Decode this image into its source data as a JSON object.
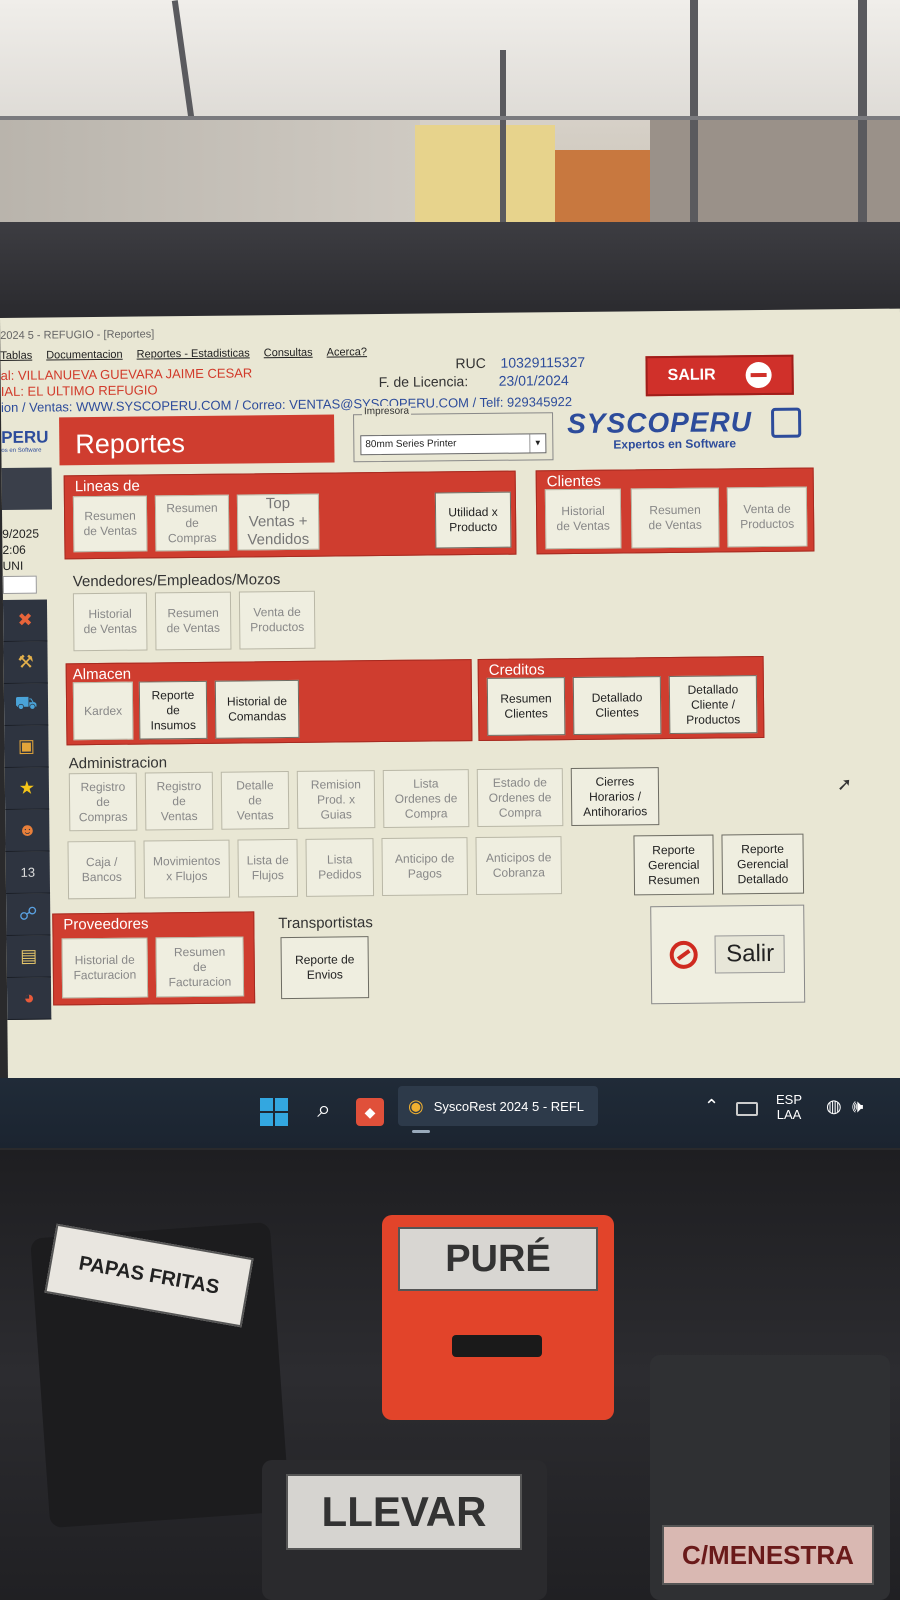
{
  "app": {
    "titlebar": "2024 5 - REFUGIO - [Reportes]",
    "menu": [
      "Tablas",
      "Documentacion",
      "Reportes - Estadisticas",
      "Consultas",
      "Acerca?"
    ],
    "owner": "al: VILLANUEVA GUEVARA JAIME CESAR",
    "branch": "IAL: EL ULTIMO REFUGIO",
    "contact": "ion / Ventas: WWW.SYSCOPERU.COM / Correo: VENTAS@SYSCOPERU.COM / Telf: 929345922",
    "ruc_label": "RUC",
    "ruc_value": "10329115327",
    "license_label": "F. de Licencia:",
    "license_value": "23/01/2024",
    "salir_top": "SALIR"
  },
  "sidebar": {
    "logo": "PERU",
    "logo_sub": "os en Software",
    "date": "9/2025",
    "time": "2:06",
    "user": "UNI",
    "tool_icons": [
      "tools-icon",
      "hammer-icon",
      "truck-icon",
      "box-icon",
      "star-icon",
      "people-icon",
      "calendar-icon",
      "user-network-icon",
      "notebook-icon",
      "pie-chart-icon"
    ]
  },
  "header": {
    "title": "Reportes",
    "printer_label": "Impresora",
    "printer_value": "80mm Series Printer",
    "brand": "SYSCOPERU",
    "brand_sub": "Expertos en Software"
  },
  "groups": {
    "lineas": {
      "title": "Lineas de",
      "buttons": [
        "Resumen\nde Ventas",
        "Resumen\nde\nCompras",
        "Top\nVentas +\nVendidos",
        "Utilidad x\nProducto"
      ]
    },
    "clientes": {
      "title": "Clientes",
      "buttons": [
        "Historial\nde Ventas",
        "Resumen\nde Ventas",
        "Venta de\nProductos"
      ]
    },
    "vendedores": {
      "title": "Vendedores/Empleados/Mozos",
      "buttons": [
        "Historial\nde Ventas",
        "Resumen\nde Ventas",
        "Venta de\nProductos"
      ]
    },
    "almacen": {
      "title": "Almacen",
      "buttons": [
        "Kardex",
        "Reporte\nde\nInsumos",
        "Historial de\nComandas"
      ]
    },
    "creditos": {
      "title": "Creditos",
      "buttons": [
        "Resumen\nClientes",
        "Detallado\nClientes",
        "Detallado\nCliente /\nProductos"
      ]
    },
    "administracion": {
      "title": "Administracion",
      "row1": [
        "Registro\nde\nCompras",
        "Registro\nde\nVentas",
        "Detalle\nde\nVentas",
        "Remision\nProd. x\nGuias",
        "Lista\nOrdenes de\nCompra",
        "Estado de\nOrdenes de\nCompra",
        "Cierres\nHorarios /\nAntihorarios"
      ],
      "row2": [
        "Caja /\nBancos",
        "Movimientos\nx Flujos",
        "Lista de\nFlujos",
        "Lista\nPedidos",
        "Anticipo de\nPagos",
        "Anticipos de\nCobranza",
        "Reporte\nGerencial\nResumen",
        "Reporte\nGerencial\nDetallado"
      ]
    },
    "proveedores": {
      "title": "Proveedores",
      "buttons": [
        "Historial de\nFacturacion",
        "Resumen\nde\nFacturacion"
      ]
    },
    "transportistas": {
      "title": "Transportistas",
      "buttons": [
        "Reporte de\nEnvios"
      ]
    }
  },
  "exit": {
    "label": "Salir"
  },
  "taskbar": {
    "app_label": "SyscoRest 2024 5 - REFL",
    "lang_top": "ESP",
    "lang_bottom": "LAA"
  },
  "stamps": [
    "PAPAS FRITAS",
    "PURÉ",
    "LLEVAR",
    "C/MENESTRA"
  ],
  "colors": {
    "accent_red": "#cf3d2f",
    "brand_blue": "#2d4c9b",
    "screen_bg": "#e9e7d4"
  }
}
